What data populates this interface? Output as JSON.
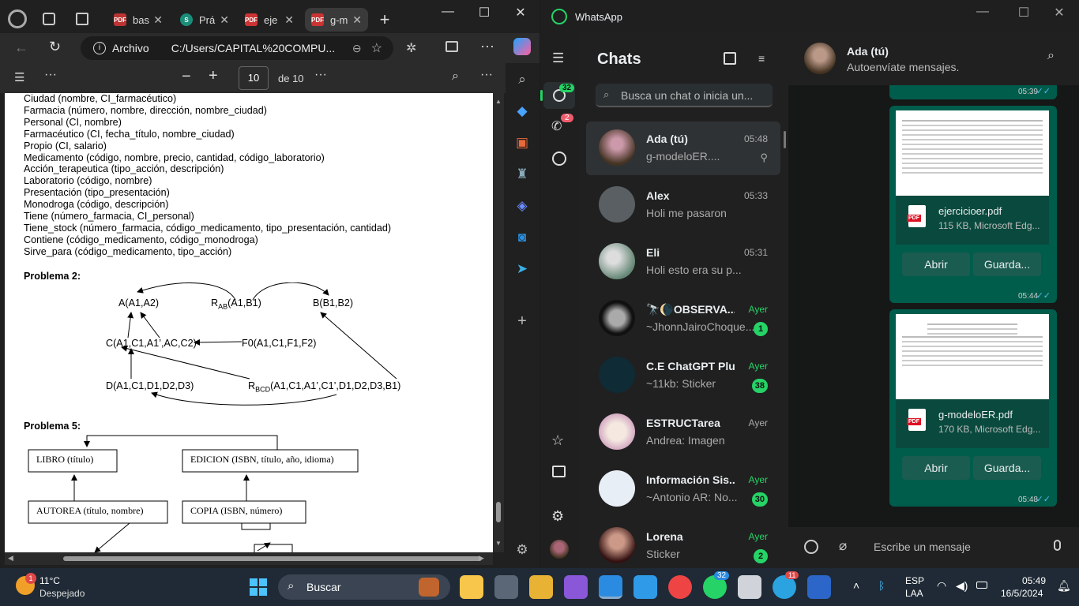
{
  "edge": {
    "tabs": [
      {
        "label": "bas",
        "fav": "pdf-icon",
        "color": "#b33"
      },
      {
        "label": "Prá",
        "fav": "s-icon",
        "color": "#1a8e7a"
      },
      {
        "label": "eje",
        "fav": "pdf-icon",
        "color": "#c33"
      },
      {
        "label": "g-m",
        "fav": "pdf-icon",
        "color": "#c33"
      }
    ],
    "address_label": "Archivo",
    "url": "C:/Users/CAPITAL%20COMPU...",
    "page_current": "10",
    "page_total": "de 10"
  },
  "pdf": {
    "lines": [
      "Ciudad (nombre, CI_farmacéutico)",
      "Farmacia (número, nombre, dirección, nombre_ciudad)",
      "Personal (CI, nombre)",
      "Farmacéutico (CI, fecha_título, nombre_ciudad)",
      "Propio (CI, salario)",
      "Medicamento (código, nombre, precio, cantidad, código_laboratorio)",
      "Acción_terapeutica (tipo_acción, descripción)",
      "Laboratorio (código, nombre)",
      "Presentación (tipo_presentación)",
      "Monodroga (código, descripción)",
      "Tiene (número_farmacia, CI_personal)",
      "Tiene_stock (número_farmacia, código_medicamento, tipo_presentación, cantidad)",
      "Contiene (código_medicamento, código_monodroga)",
      "Sirve_para (código_medicamento, tipo_acción)"
    ],
    "problema2": "Problema 2:",
    "problema5": "Problema 5:",
    "p2_nodes": {
      "a": "A(A1,A2)",
      "rab": "R",
      "rab_sub": "AB",
      "rab_args": "(A1,B1)",
      "b": "B(B1,B2)",
      "c": "C(A1,C1,A1’,AC,C2)",
      "f0": "F0(A1,C1,F1,F2)",
      "d": "D(A1,C1,D1,D2,D3)",
      "rbcd": "R",
      "rbcd_sub": "BCD",
      "rbcd_args": "(A1,C1,A1’,C1’,D1,D2,D3,B1)"
    },
    "p5_boxes": {
      "libro": "LIBRO (título)",
      "edicion": "EDICION (ISBN, título, año, idioma)",
      "autorea": "AUTOREA (título, nombre)",
      "copia": "COPIA (ISBN, número)"
    }
  },
  "whatsapp": {
    "app_title": "WhatsApp",
    "chats_title": "Chats",
    "search_placeholder": "Busca un chat o inicia un...",
    "chats_badge": "32",
    "calls_badge": "2",
    "chats": [
      {
        "name": "Ada (tú)",
        "time": "05:48",
        "preview": "g-modeloER....",
        "green": false,
        "badge": ""
      },
      {
        "name": "Alex",
        "time": "05:33",
        "preview": "Holi me pasaron",
        "green": false,
        "badge": ""
      },
      {
        "name": "Eli",
        "time": "05:31",
        "preview": "Holi esto era su p...",
        "green": false,
        "badge": ""
      },
      {
        "name": "🔭🌘OBSERVA...",
        "time": "Ayer",
        "preview": "~JhonnJairoChoque...",
        "green": true,
        "badge": "1"
      },
      {
        "name": "C.E ChatGPT Plus",
        "time": "Ayer",
        "preview": "~11kb: Sticker",
        "green": true,
        "badge": "38"
      },
      {
        "name": "ESTRUCTarea",
        "time": "Ayer",
        "preview": "Andrea: Imagen",
        "green": false,
        "badge": ""
      },
      {
        "name": "Información Sis...",
        "time": "Ayer",
        "preview": "~Antonio AR: No...",
        "green": true,
        "badge": "30"
      },
      {
        "name": "Lorena",
        "time": "Ayer",
        "preview": "Sticker",
        "green": true,
        "badge": "2"
      }
    ],
    "header": {
      "name": "Ada (tú)",
      "status": "Autoenvíate mensajes."
    },
    "messages": [
      {
        "time_top": "05:39"
      },
      {
        "file": "ejercicioer.pdf",
        "meta": "115 KB, Microsoft Edg...",
        "open": "Abrir",
        "save": "Guarda...",
        "time": "05:44"
      },
      {
        "file": "g-modeloER.pdf",
        "meta": "170 KB, Microsoft Edg...",
        "open": "Abrir",
        "save": "Guarda...",
        "time": "05:48"
      }
    ],
    "compose_placeholder": "Escribe un mensaje"
  },
  "taskbar": {
    "weather_temp": "11°C",
    "weather_desc": "Despejado",
    "weather_badge": "1",
    "search": "Buscar",
    "wa_badge": "32",
    "tg_badge": "11",
    "lang1": "ESP",
    "lang2": "LAA",
    "time": "05:49",
    "date": "16/5/2024"
  }
}
